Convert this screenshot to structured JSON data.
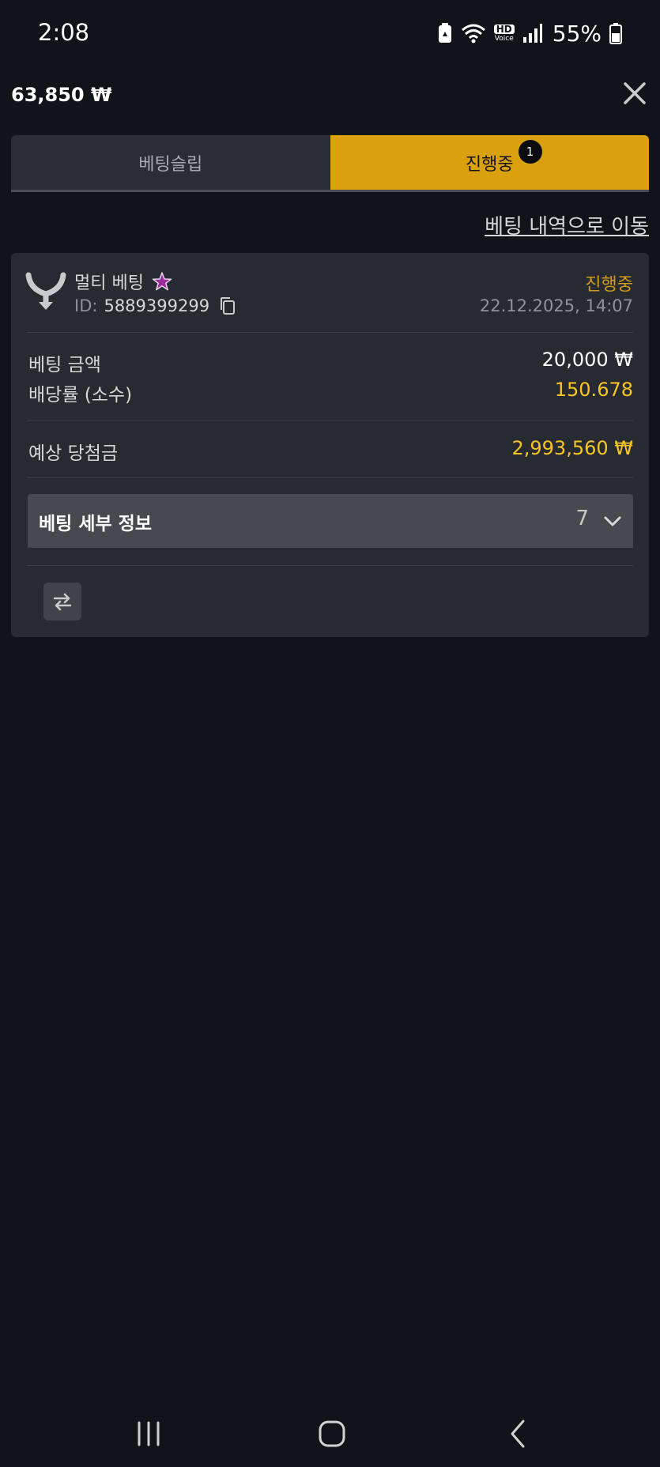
{
  "status_bar": {
    "time": "2:08",
    "battery_percent": "55%",
    "icons": [
      "battery-saver-icon",
      "wifi-icon",
      "hd-voice-icon",
      "signal-icon",
      "battery-icon"
    ],
    "hd_voice_top": "HD",
    "hd_voice_bottom": "Voice"
  },
  "header": {
    "balance": "63,850 ₩",
    "close_icon": "close-icon"
  },
  "tabs": [
    {
      "label": "베팅슬립",
      "active": false
    },
    {
      "label": "진행중",
      "active": true,
      "badge": "1"
    }
  ],
  "history_link": "베팅 내역으로 이동",
  "bet": {
    "type": "멀티 베팅",
    "id_label": "ID:",
    "id": "5889399299",
    "status": "진행중",
    "date": "22.12.2025, 14:07",
    "stake_label": "베팅 금액",
    "stake_value": "20,000 ₩",
    "odds_label": "배당률 (소수)",
    "odds_value": "150.678",
    "payout_label": "예상 당첨금",
    "payout_value": "2,993,560 ₩",
    "details_label": "베팅 세부 정보",
    "details_count": "7"
  },
  "colors": {
    "background": "#10131a",
    "card": "#272a31",
    "accent": "#dba00e",
    "status": "#d29a1a",
    "highlight_value": "#f7c623",
    "star": "#9b2c9e"
  }
}
